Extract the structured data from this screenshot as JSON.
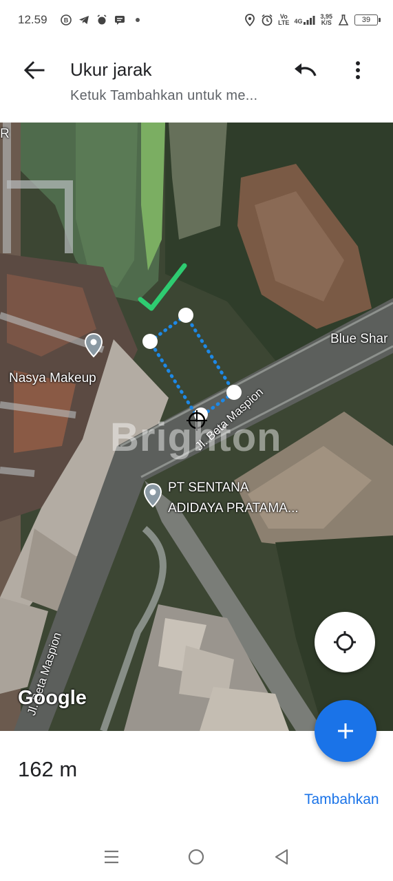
{
  "status_bar": {
    "time": "12.59",
    "network_label_top": "Vo",
    "network_label_bottom": "LTE",
    "signal_label": "4G",
    "speed_value": "3,95",
    "speed_unit": "K/S",
    "battery": "39"
  },
  "app_bar": {
    "title": "Ukur jarak",
    "subtitle": "Ketuk Tambahkan untuk me..."
  },
  "map": {
    "places": [
      {
        "name": "Nasya Makeup"
      },
      {
        "name_line1": "PT SENTANA",
        "name_line2": "ADIDAYA PRATAMA..."
      }
    ],
    "road_labels": {
      "beta_maspion": "Jl. Beta Maspion",
      "blue_shar": "Blue Shar",
      "bottom_road": "Jl. Beta Maspion",
      "edge_letter": "R"
    },
    "watermark": "Brighton",
    "google_logo": "Google",
    "measure_color": "#1e88e5",
    "checkmark_color": "#2ecc71"
  },
  "measurement": {
    "distance": "162 m",
    "add_label": "Tambahkan"
  },
  "colors": {
    "accent": "#1a73e8"
  }
}
